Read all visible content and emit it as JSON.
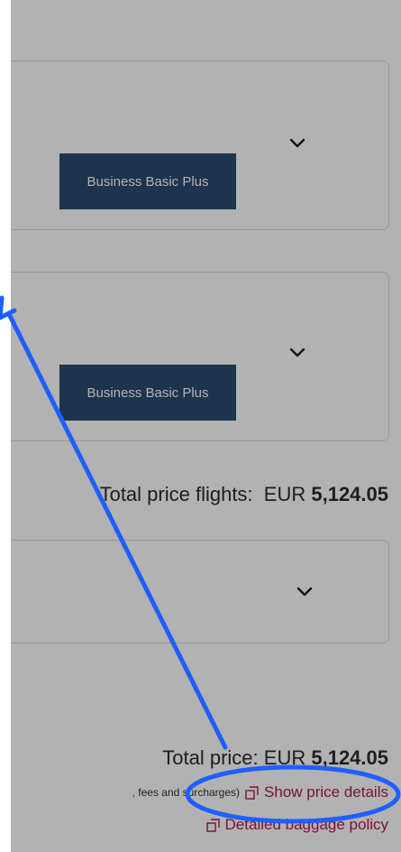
{
  "flights": [
    {
      "fare_label": "Business Basic Plus"
    },
    {
      "fare_label": "Business Basic Plus"
    }
  ],
  "total_flights": {
    "label": "Total price flights:",
    "currency": "EUR",
    "amount": "5,124.05"
  },
  "total": {
    "label": "Total price:",
    "currency": "EUR",
    "amount": "5,124.05"
  },
  "fees_text": ", fees and surcharges)",
  "links": {
    "price_details": "Show price details",
    "baggage_policy": "Detailed baggage policy"
  },
  "icons": {
    "expand": "chevron-down-icon",
    "external": "external-link-icon"
  },
  "colors": {
    "badge": "#2b4a6f",
    "link": "#b01a4a",
    "annotation": "#1f5fff"
  }
}
